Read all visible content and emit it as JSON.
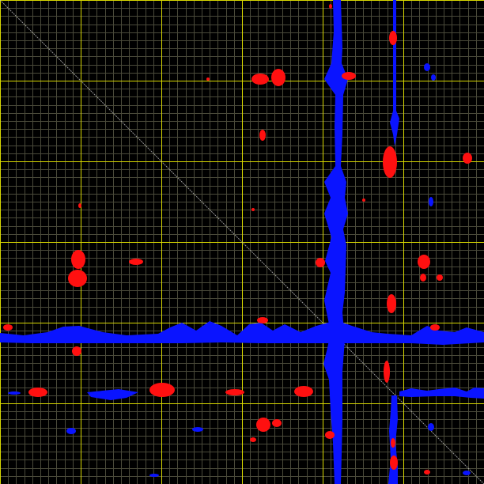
{
  "colors": {
    "background": "#000000",
    "grid_minor": "#4a4a3a",
    "grid_major": "#d8d800",
    "diagonal": "#bdbdbd",
    "positive_peaks": "#0a14ff",
    "negative_peaks": "#ff1010"
  },
  "view": {
    "minor_grid_divisions": 60,
    "major_grid_every": 10,
    "diagonal_shown": true
  }
}
